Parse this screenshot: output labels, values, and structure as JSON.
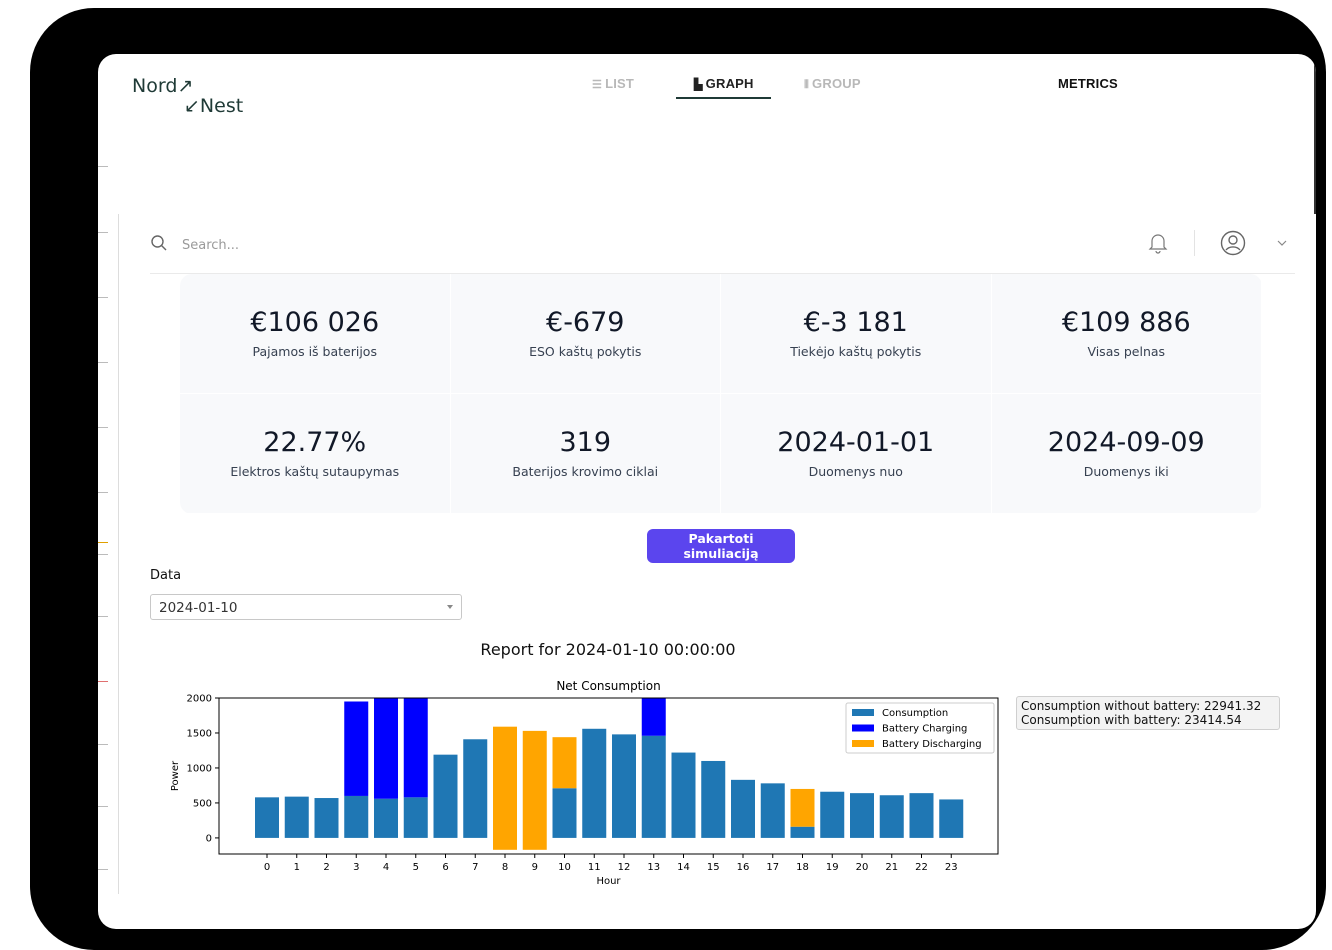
{
  "nav": {
    "logo_line1": "Nord",
    "logo_line2": "Nest",
    "list": "LIST",
    "graph": "GRAPH",
    "group": "GROUP",
    "metrics": "METRICS"
  },
  "search": {
    "placeholder": "Search..."
  },
  "icons": {
    "search": "search-icon",
    "bell": "bell-icon",
    "user": "user-avatar-icon",
    "chevron": "chevron-down-icon"
  },
  "metrics": [
    {
      "value": "€106 026",
      "label": "Pajamos iš baterijos"
    },
    {
      "value": "€-679",
      "label": "ESO kaštų pokytis"
    },
    {
      "value": "€-3 181",
      "label": "Tiekėjo kaštų pokytis"
    },
    {
      "value": "€109 886",
      "label": "Visas pelnas"
    },
    {
      "value": "22.77%",
      "label": "Elektros kaštų sutaupymas"
    },
    {
      "value": "319",
      "label": "Baterijos krovimo ciklai"
    },
    {
      "value": "2024-01-01",
      "label": "Duomenys nuo"
    },
    {
      "value": "2024-09-09",
      "label": "Duomenys iki"
    }
  ],
  "actions": {
    "rerun": "Pakartoti simuliaciją"
  },
  "date_filter": {
    "label": "Data",
    "value": "2024-01-10"
  },
  "report_title": "Report for 2024-01-10 00:00:00",
  "stats": {
    "without_battery": "Consumption without battery: 22941.32",
    "with_battery": "Consumption with battery: 23414.54"
  },
  "colors": {
    "consumption": "#1f77b4",
    "charging": "#0000ff",
    "discharging": "#ffa500",
    "accent": "#5b45ee"
  },
  "chart_data": {
    "type": "bar",
    "stacked": true,
    "title": "Net Consumption",
    "xlabel": "Hour",
    "ylabel": "Power",
    "categories": [
      "0",
      "1",
      "2",
      "3",
      "4",
      "5",
      "6",
      "7",
      "8",
      "9",
      "10",
      "11",
      "12",
      "13",
      "14",
      "15",
      "16",
      "17",
      "18",
      "19",
      "20",
      "21",
      "22",
      "23"
    ],
    "yticks": [
      0,
      500,
      1000,
      1500,
      2000
    ],
    "ylim": [
      -230,
      2000
    ],
    "legend_position": "upper right",
    "series": [
      {
        "name": "Consumption",
        "color": "#1f77b4",
        "values": [
          580,
          590,
          570,
          600,
          560,
          580,
          1190,
          1410,
          null,
          null,
          710,
          1560,
          1480,
          1460,
          1220,
          1100,
          830,
          780,
          160,
          660,
          640,
          610,
          640,
          550
        ]
      },
      {
        "name": "Battery Charging",
        "color": "#0000ff",
        "values": [
          0,
          0,
          0,
          1350,
          1440,
          1420,
          0,
          0,
          0,
          0,
          0,
          0,
          0,
          540,
          0,
          0,
          0,
          0,
          0,
          0,
          0,
          0,
          0,
          0
        ]
      },
      {
        "name": "Battery Discharging",
        "color": "#ffa500",
        "from": [
          null,
          null,
          null,
          null,
          null,
          null,
          null,
          null,
          -170,
          -170,
          710,
          null,
          null,
          null,
          null,
          null,
          null,
          null,
          160,
          null,
          null,
          null,
          null,
          null
        ],
        "to": [
          null,
          null,
          null,
          null,
          null,
          null,
          null,
          null,
          1590,
          1530,
          1440,
          null,
          null,
          null,
          null,
          null,
          null,
          null,
          700,
          null,
          null,
          null,
          null,
          null
        ]
      }
    ]
  }
}
